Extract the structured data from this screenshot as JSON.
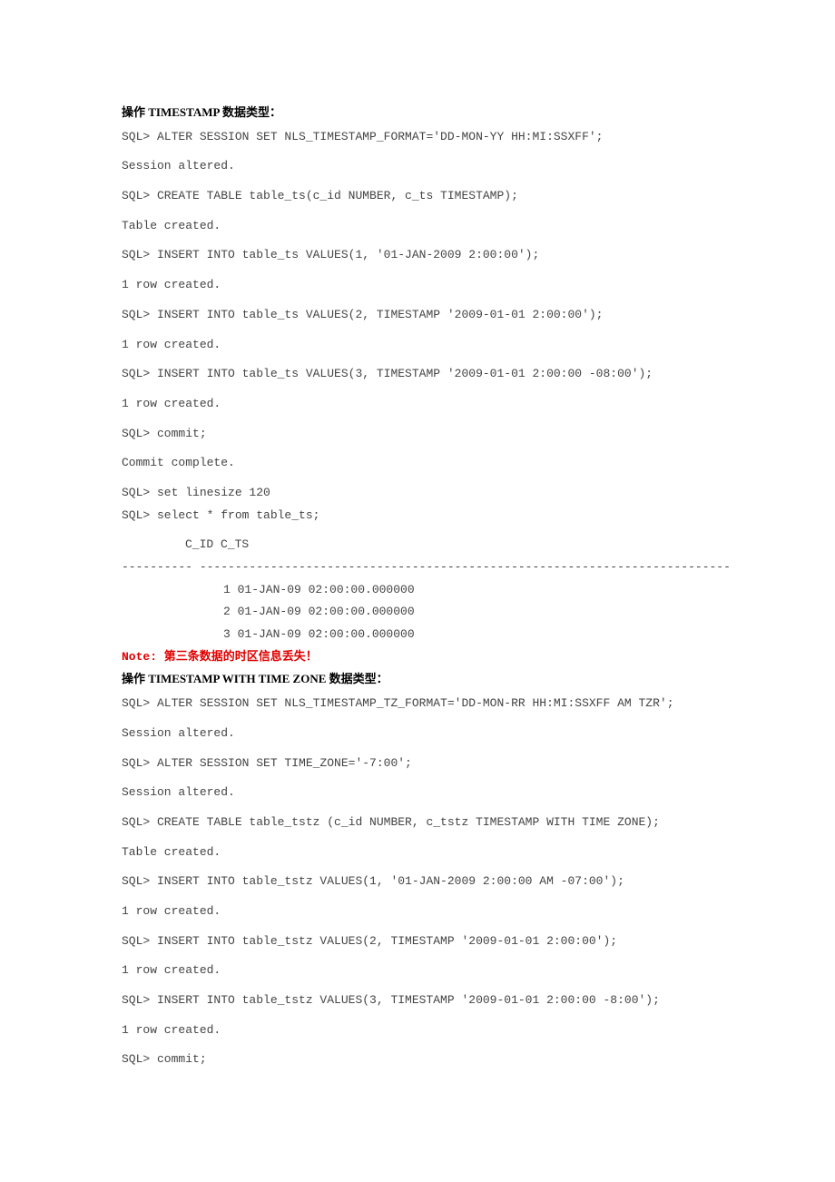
{
  "section1": {
    "heading": "操作 TIMESTAMP 数据类型：",
    "lines": [
      "SQL> ALTER SESSION SET NLS_TIMESTAMP_FORMAT='DD-MON-YY HH:MI:SSXFF';",
      "Session altered.",
      "SQL> CREATE TABLE table_ts(c_id NUMBER, c_ts TIMESTAMP);",
      "Table created.",
      "SQL> INSERT INTO table_ts VALUES(1, '01-JAN-2009 2:00:00');",
      "1 row created.",
      "SQL> INSERT INTO table_ts VALUES(2, TIMESTAMP '2009-01-01 2:00:00');",
      "1 row created.",
      "SQL> INSERT INTO table_ts VALUES(3, TIMESTAMP '2009-01-01 2:00:00 -08:00');",
      "1 row created.",
      "SQL> commit;",
      "Commit complete.",
      "SQL> set linesize 120"
    ],
    "select": "SQL> select * from table_ts;",
    "colheader": "C_ID C_TS",
    "dashes": "---------- ---------------------------------------------------------------------------",
    "rows": [
      "1 01-JAN-09 02:00:00.000000",
      "2 01-JAN-09 02:00:00.000000",
      "3 01-JAN-09 02:00:00.000000"
    ]
  },
  "note": "Note: 第三条数据的时区信息丢失！",
  "section2": {
    "heading": "操作 TIMESTAMP WITH TIME ZONE 数据类型：",
    "lines": [
      "SQL> ALTER SESSION SET NLS_TIMESTAMP_TZ_FORMAT='DD-MON-RR HH:MI:SSXFF AM TZR';",
      "Session altered.",
      "SQL> ALTER SESSION SET TIME_ZONE='-7:00';",
      "Session altered.",
      "SQL> CREATE TABLE table_tstz (c_id NUMBER, c_tstz TIMESTAMP WITH TIME ZONE);",
      "Table created.",
      "SQL> INSERT INTO table_tstz VALUES(1, '01-JAN-2009 2:00:00 AM -07:00');",
      "1 row created.",
      "SQL> INSERT INTO table_tstz VALUES(2, TIMESTAMP '2009-01-01 2:00:00');",
      "1 row created.",
      "SQL> INSERT INTO table_tstz VALUES(3, TIMESTAMP '2009-01-01 2:00:00 -8:00');",
      "1 row created.",
      "SQL> commit;"
    ]
  }
}
